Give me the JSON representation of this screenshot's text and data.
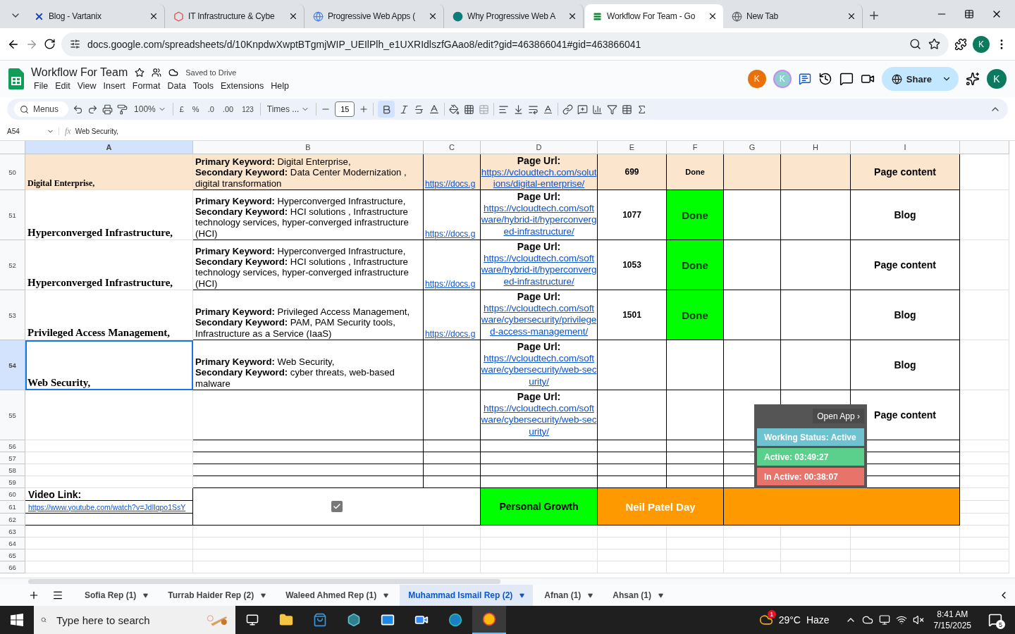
{
  "browser": {
    "tabs": [
      {
        "title": "Blog - Vartanix",
        "selected": false
      },
      {
        "title": "IT Infrastructure & Cybe",
        "selected": false
      },
      {
        "title": "Progressive Web Apps (",
        "selected": false
      },
      {
        "title": "Why Progressive Web A",
        "selected": false
      },
      {
        "title": "Workflow For Team - Go",
        "selected": true
      },
      {
        "title": "New Tab",
        "selected": false
      }
    ],
    "address": "docs.google.com/spreadsheets/d/10KnpdwXwptBTgmjWIP_UEIlPlh_e1UXRIdlszfGAao8/edit?gid=463866041#gid=463866041",
    "profile": "K"
  },
  "doc": {
    "title": "Workflow For Team",
    "save_status": "Saved to Drive",
    "menus": [
      "File",
      "Edit",
      "View",
      "Insert",
      "Format",
      "Data",
      "Tools",
      "Extensions",
      "Help"
    ],
    "collaborators": [
      {
        "initial": "K",
        "color": "#e8710a"
      },
      {
        "initial": "K",
        "color": "#8fcfcc"
      }
    ],
    "share": "Share",
    "account": "K"
  },
  "toolbar": {
    "search": "Menus",
    "zoom": "100%",
    "currency": "£",
    "percent": "%",
    "decrease_decimals": ".0",
    "increase_decimals": ".00",
    "number_format": "123",
    "font": "Times ...",
    "font_size": "15",
    "bold": true
  },
  "formula_bar": {
    "cell_ref": "A54",
    "fx": "fx",
    "value": "Web Security,"
  },
  "sheet": {
    "columns": [
      {
        "label": "A",
        "selected": true
      },
      {
        "label": "B",
        "selected": false
      },
      {
        "label": "C",
        "selected": false
      },
      {
        "label": "D",
        "selected": false
      },
      {
        "label": "E",
        "selected": false
      },
      {
        "label": "F",
        "selected": false
      },
      {
        "label": "G",
        "selected": false
      },
      {
        "label": "H",
        "selected": false
      },
      {
        "label": "I",
        "selected": false
      }
    ],
    "rows": [
      {
        "number": "50",
        "selected": false,
        "highlighted": true,
        "topic": "Digital Enterprise,",
        "keywords": "**Primary Keyword:** Digital Enterprise,\n**Secondary Keyword:** Data Center Modernization , digital transformation",
        "doc_link": "https://docs.g",
        "page_url_label": "Page Url:",
        "page_url": "https://vcloudtech.com/solutions/digital-enterprise/",
        "words": "699",
        "status": {
          "text": "Done"
        },
        "type": "Page content"
      },
      {
        "number": "51",
        "selected": false,
        "highlighted": false,
        "topic": "Hyperconverged Infrastructure,",
        "keywords": "**Primary Keyword:** Hyperconverged Infrastructure,\n**Secondary Keyword:** HCI solutions , Infrastructure technology services, hyper-converged infrastructure (HCI)",
        "doc_link": "https://docs.g",
        "page_url_label": "Page Url:",
        "page_url": "https://vcloudtech.com/software/hybrid-it/hyperconverged-infrastructure/",
        "words": "1077",
        "status": {
          "text": "Done",
          "color": "#00ff00"
        },
        "type": "Blog"
      },
      {
        "number": "52",
        "selected": false,
        "highlighted": false,
        "topic": "Hyperconverged Infrastructure,",
        "keywords": "**Primary Keyword:** Hyperconverged Infrastructure,\n**Secondary Keyword:** HCI solutions , Infrastructure technology services, hyper-converged infrastructure (HCI)",
        "doc_link": "https://docs.g",
        "page_url_label": "Page Url:",
        "page_url": "https://vcloudtech.com/software/hybrid-it/hyperconverged-infrastructure/",
        "words": "1053",
        "status": {
          "text": "Done",
          "color": "#00ff00"
        },
        "type": "Page content"
      },
      {
        "number": "53",
        "selected": false,
        "highlighted": false,
        "topic": "Privileged Access Management,",
        "keywords": "**Primary Keyword:** Privileged Access Management,\n**Secondary Keyword:** PAM, PAM Security tools, Infrastructure as a Service (IaaS)",
        "doc_link": "https://docs.g",
        "page_url_label": "Page Url:",
        "page_url": "https://vcloudtech.com/software/cybersecurity/privileged-access-management/",
        "words": "1501",
        "status": {
          "text": "Done",
          "color": "#00ff00"
        },
        "type": "Blog"
      },
      {
        "number": "54",
        "selected": true,
        "highlighted": false,
        "topic": "Web Security,",
        "keywords": "**Primary Keyword:** Web Security,\n**Secondary Keyword:** cyber threats, web-based malware",
        "page_url_label": "Page Url:",
        "page_url": "https://vcloudtech.com/software/cybersecurity/web-security/",
        "type": "Blog"
      },
      {
        "number": "55",
        "selected": false,
        "highlighted": false,
        "page_url_label": "Page Url:",
        "page_url": "https://vcloudtech.com/software/cybersecurity/web-security/",
        "type": "Page content"
      }
    ],
    "empty_rows": [
      "56",
      "57",
      "58",
      "59"
    ],
    "summary": {
      "rows": [
        "60",
        "61",
        "62"
      ],
      "video_label": "Video Link:",
      "video_url": "https://www.youtube.com/watch?v=JdIlqpo1SsY",
      "checked": true,
      "category": {
        "text": "Personal Growth",
        "color": "#00ff00"
      },
      "day": {
        "text": "Neil Patel Day",
        "color": "#ff9900"
      }
    },
    "trailing_rows": [
      "63",
      "64",
      "65",
      "66"
    ]
  },
  "tracker": {
    "button": "Open App ›",
    "status": "Working Status: Active",
    "active": "Active: 03:49:27",
    "inactive": "In Active: 00:38:07"
  },
  "sheet_tabs": [
    {
      "label": "Sofia Rep (1)",
      "selected": false
    },
    {
      "label": "Turrab Haider Rep (2)",
      "selected": false
    },
    {
      "label": "Waleed Ahmed Rep (1)",
      "selected": false
    },
    {
      "label": "Muhammad Ismail Rep (2)",
      "selected": true
    },
    {
      "label": "Afnan (1)",
      "selected": false
    },
    {
      "label": "Ahsan (1)",
      "selected": false
    }
  ],
  "taskbar": {
    "search_placeholder": "Type here to search",
    "weather_badge": "1",
    "temperature": "29°C",
    "condition": "Haze",
    "time": "8:41 AM",
    "date": "7/15/2025",
    "notifications": "5"
  }
}
